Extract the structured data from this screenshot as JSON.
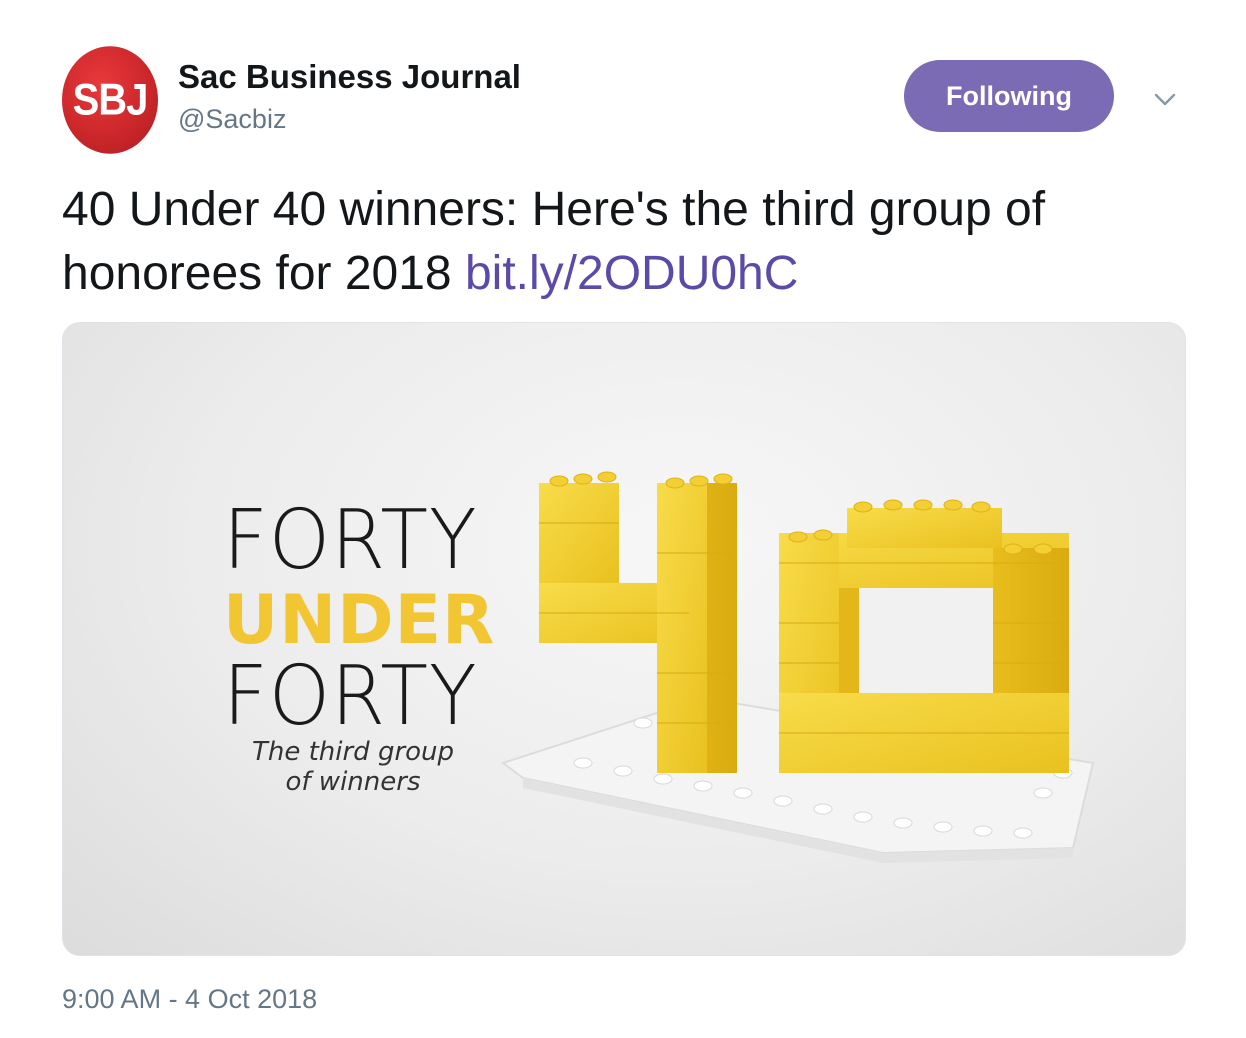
{
  "account": {
    "avatar_text": "SBJ",
    "display_name": "Sac Business Journal",
    "handle": "@Sacbiz",
    "follow_button_label": "Following"
  },
  "tweet": {
    "text": "40 Under 40 winners: Here's the third group of honorees for 2018",
    "link": "bit.ly/2ODU0hC",
    "timestamp": "9:00 AM - 4 Oct 2018"
  },
  "media": {
    "line1": "FORTY",
    "line2": "UNDER",
    "line3": "FORTY",
    "subtitle_line1": "The third group",
    "subtitle_line2": "of winners"
  },
  "colors": {
    "brand_red": "#c9262a",
    "follow_purple": "#7b6bb5",
    "link_purple": "#5b4aa8",
    "accent_yellow": "#f2c533",
    "muted_gray": "#657786"
  },
  "icons": {
    "caret": "chevron-down-icon"
  }
}
